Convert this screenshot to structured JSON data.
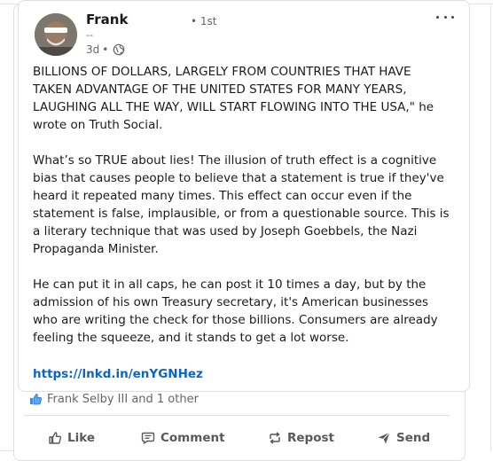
{
  "post": {
    "author_name": "Frank",
    "connection_degree": "• 1st",
    "headline": "--",
    "age": "3d",
    "meta_separator": "•",
    "visibility_icon": "globe-icon",
    "body": "BILLIONS OF DOLLARS, LARGELY FROM COUNTRIES THAT HAVE TAKEN ADVANTAGE OF THE UNITED STATES FOR MANY YEARS, LAUGHING ALL THE WAY, WILL START FLOWING INTO THE USA,\" he wrote on Truth Social.\n\nWhat’s so TRUE about lies! The illusion of truth effect is a cognitive bias that causes people to believe that a statement is true if they've heard it repeated many times. This effect can occur even if the statement is false, implausible, or from a questionable source. This is a literary technique that was used by Joseph Goebbels, the Nazi Propaganda Minister.\n\nHe can put it in all caps, he can post it 10 times a day, but by the admission of his own Treasury secretary, it's American businesses who are writing the check for those billions. Consumers are already feeling the squeeze, and it stands to get a lot worse.",
    "link": "https://lnkd.in/enYGNHez"
  },
  "social": {
    "reactions_text": "Frank Selby III and 1 other"
  },
  "actions": {
    "like": "Like",
    "comment": "Comment",
    "repost": "Repost",
    "send": "Send"
  },
  "colors": {
    "link": "#0a66c2",
    "muted": "#666666",
    "action": "#595959",
    "border": "#e0dfdc"
  }
}
